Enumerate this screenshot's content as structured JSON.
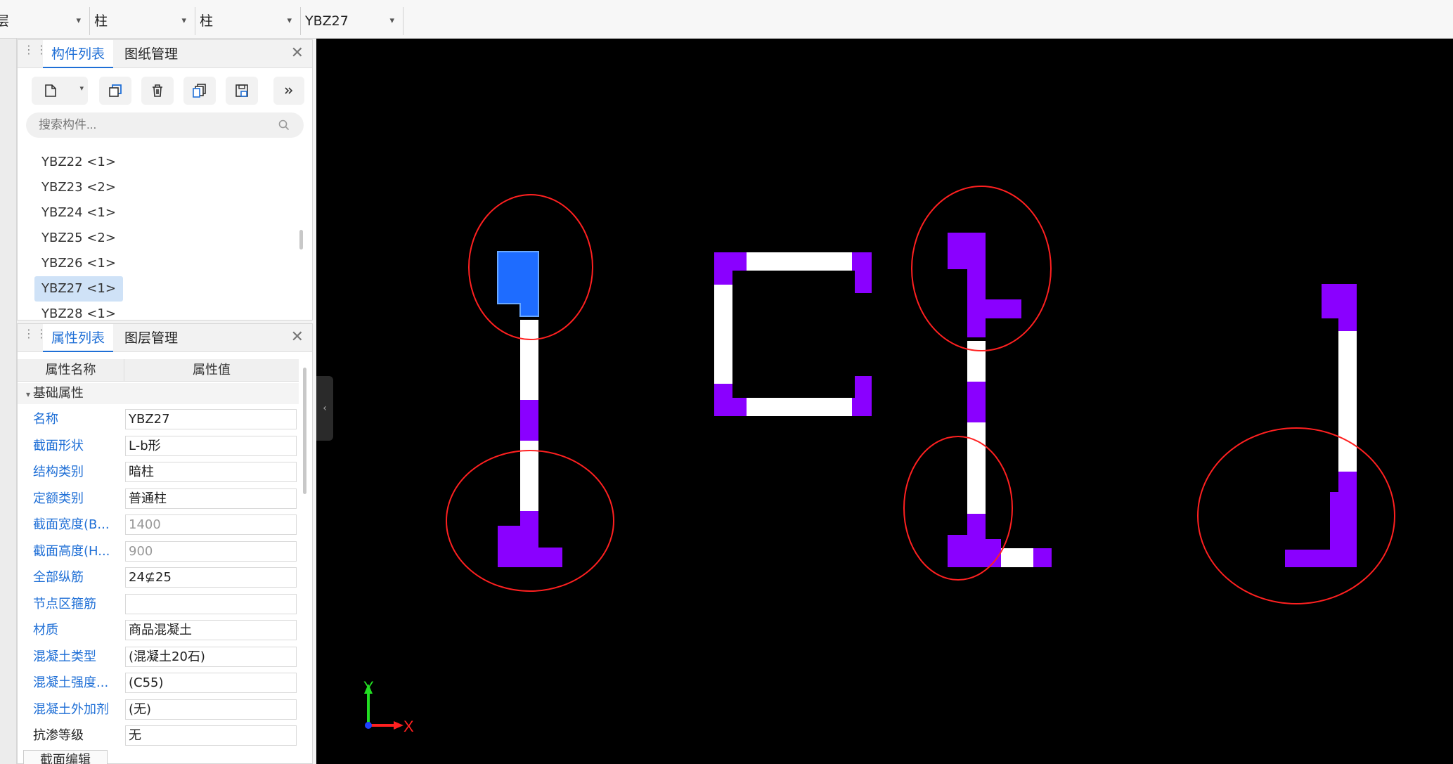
{
  "toolbar": {
    "dropdowns": [
      {
        "value": "层"
      },
      {
        "value": "柱"
      },
      {
        "value": "柱"
      },
      {
        "value": "YBZ27"
      }
    ]
  },
  "component_panel": {
    "tabs": [
      {
        "label": "构件列表"
      },
      {
        "label": "图纸管理"
      }
    ],
    "search_placeholder": "搜索构件...",
    "items": [
      {
        "label": "YBZ22 <1>"
      },
      {
        "label": "YBZ23 <2>"
      },
      {
        "label": "YBZ24 <1>"
      },
      {
        "label": "YBZ25 <2>"
      },
      {
        "label": "YBZ26 <1>"
      },
      {
        "label": "YBZ27 <1>",
        "selected": true
      },
      {
        "label": "YBZ28 <1>"
      }
    ]
  },
  "property_panel": {
    "tabs": [
      {
        "label": "属性列表"
      },
      {
        "label": "图层管理"
      }
    ],
    "header": {
      "name_col": "属性名称",
      "value_col": "属性值"
    },
    "group": "基础属性",
    "rows": [
      {
        "name": "名称",
        "value": "YBZ27"
      },
      {
        "name": "截面形状",
        "value": "L-b形"
      },
      {
        "name": "结构类别",
        "value": "暗柱"
      },
      {
        "name": "定额类别",
        "value": "普通柱"
      },
      {
        "name": "截面宽度(B...",
        "value": "1400"
      },
      {
        "name": "截面高度(H...",
        "value": "900"
      },
      {
        "name": "全部纵筋",
        "value": "24⊈25"
      },
      {
        "name": "节点区箍筋",
        "value": ""
      },
      {
        "name": "材质",
        "value": "商品混凝土"
      },
      {
        "name": "混凝土类型",
        "value": "(混凝土20石)"
      },
      {
        "name": "混凝土强度...",
        "value": "(C55)"
      },
      {
        "name": "混凝土外加剂",
        "value": "(无)"
      },
      {
        "name": "抗渗等级",
        "value": "无"
      }
    ],
    "edit_button": "截面编辑"
  },
  "canvas": {
    "axis_x": "X",
    "axis_y": "Y",
    "colors": {
      "background": "#000000",
      "wall": "#ffffff",
      "column": "#8a00ff",
      "selected": "#1e6cff",
      "markup": "#ff2020"
    }
  }
}
